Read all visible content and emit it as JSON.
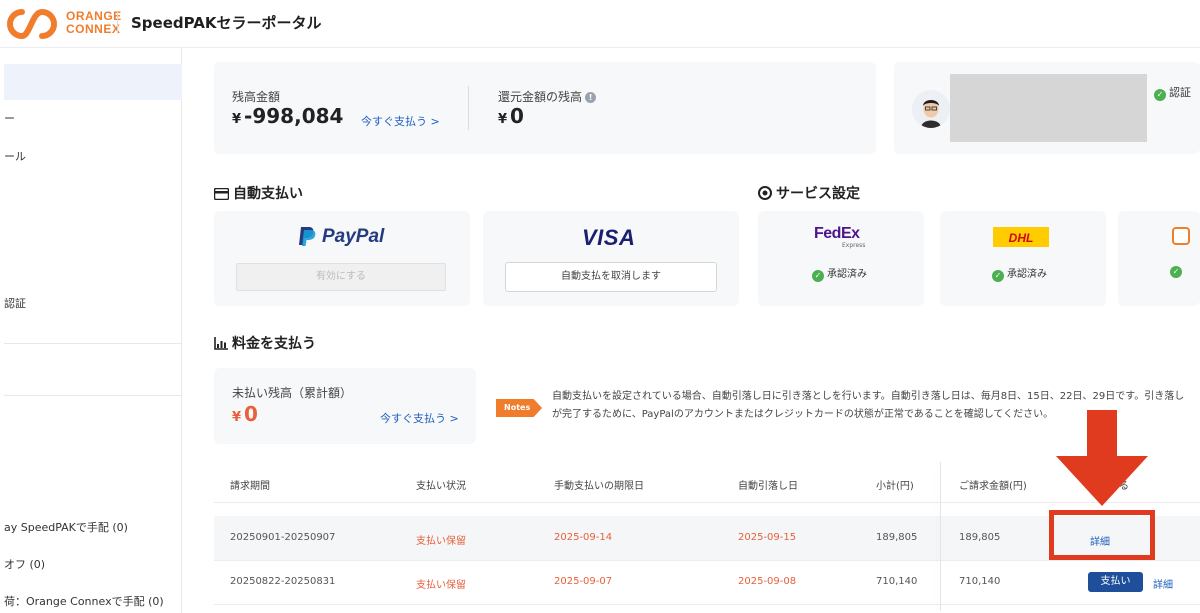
{
  "header": {
    "logo_line1": "ORANGE",
    "logo_line2": "CONNEX",
    "portal_title": "SpeedPAKセラーポータル"
  },
  "sidebar": {
    "items": [
      "ー",
      "ール",
      "認証",
      "ay SpeedPAKで手配 (0)",
      "オフ (0)",
      "荷：Orange Connexで手配 (0)"
    ]
  },
  "balance": {
    "label": "残高金額",
    "currency": "¥",
    "value": "-998,084",
    "pay_now": "今すぐ支払う >",
    "refund_label": "還元金額の残高",
    "refund_currency": "¥",
    "refund_value": "0"
  },
  "profile": {
    "verified_label": "認証"
  },
  "auto_pay": {
    "title": "自動支払い",
    "paypal_logo": "PayPal",
    "paypal_button": "有効にする",
    "visa_logo": "VISA",
    "visa_button": "自動支払を取消します"
  },
  "services": {
    "title": "サービス設定",
    "fedex_logo_main": "FedEx",
    "fedex_logo_sub": "Express",
    "dhl_logo": "DHL",
    "status": "承認済み"
  },
  "payment": {
    "title": "料金を支払う",
    "unpaid_label": "未払い残高（累計額）",
    "unpaid_currency": "¥",
    "unpaid_value": "0",
    "pay_now": "今すぐ支払う >",
    "notes_badge": "Notes",
    "notes_text": "自動支払いを設定されている場合、自動引落し日に引き落としを行います。自動引き落し日は、毎月8日、15日、22日、29日です。引き落しが完了するために、PayPalのアカウントまたはクレジットカードの状態が正常であることを確認してください。"
  },
  "table": {
    "headers": [
      "請求期間",
      "支払い状況",
      "手動支払いの期限日",
      "自動引落し日",
      "小計(円)",
      "ご請求金額(円)",
      "る"
    ],
    "rows": [
      {
        "period": "20250901-20250907",
        "status": "支払い保留",
        "manual_due": "2025-09-14",
        "auto_date": "2025-09-15",
        "subtotal": "189,805",
        "amount": "189,805",
        "detail": "詳細"
      },
      {
        "period": "20250822-20250831",
        "status": "支払い保留",
        "manual_due": "2025-09-07",
        "auto_date": "2025-09-08",
        "subtotal": "710,140",
        "amount": "710,140",
        "pay_button": "支払い",
        "detail": "詳細"
      }
    ]
  },
  "colors": {
    "brand_orange": "#f07d2b",
    "link_blue": "#1f5fbf",
    "button_navy": "#1f4e9b",
    "status_red": "#e8603c",
    "annotation_red": "#e03a1f",
    "approved_green": "#4caf50"
  }
}
